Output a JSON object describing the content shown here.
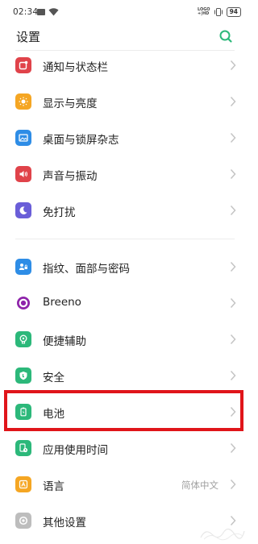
{
  "status_bar": {
    "time": "02:34",
    "network_line1": "LOGO",
    "network_line2": "+|HD",
    "battery": "94"
  },
  "header": {
    "title": "设置"
  },
  "colors": {
    "accent": "#2cb87a",
    "highlight": "#e0151a"
  },
  "settings": [
    {
      "label": "通知与状态栏",
      "icon": "notification-icon",
      "color": "#e0434a"
    },
    {
      "label": "显示与亮度",
      "icon": "brightness-icon",
      "color": "#f5a623"
    },
    {
      "label": "桌面与锁屏杂志",
      "icon": "wallpaper-icon",
      "color": "#2e8de6"
    },
    {
      "label": "声音与振动",
      "icon": "sound-icon",
      "color": "#e0434a"
    },
    {
      "label": "免打扰",
      "icon": "moon-icon",
      "color": "#6a5ed8"
    },
    {
      "label": "指纹、面部与密码",
      "icon": "fingerprint-icon",
      "color": "#2e8de6"
    },
    {
      "label": "Breeno",
      "icon": "breeno-icon",
      "color": "#9c27b0"
    },
    {
      "label": "便捷辅助",
      "icon": "assist-icon",
      "color": "#2cb87a"
    },
    {
      "label": "安全",
      "icon": "shield-icon",
      "color": "#2cb87a"
    },
    {
      "label": "电池",
      "icon": "battery-icon",
      "color": "#2cb87a"
    },
    {
      "label": "应用使用时间",
      "icon": "app-usage-icon",
      "color": "#2cb87a"
    },
    {
      "label": "语言",
      "icon": "language-icon",
      "color": "#f5a623",
      "value": "简体中文"
    },
    {
      "label": "其他设置",
      "icon": "other-settings-icon",
      "color": "#9e9e9e"
    }
  ]
}
